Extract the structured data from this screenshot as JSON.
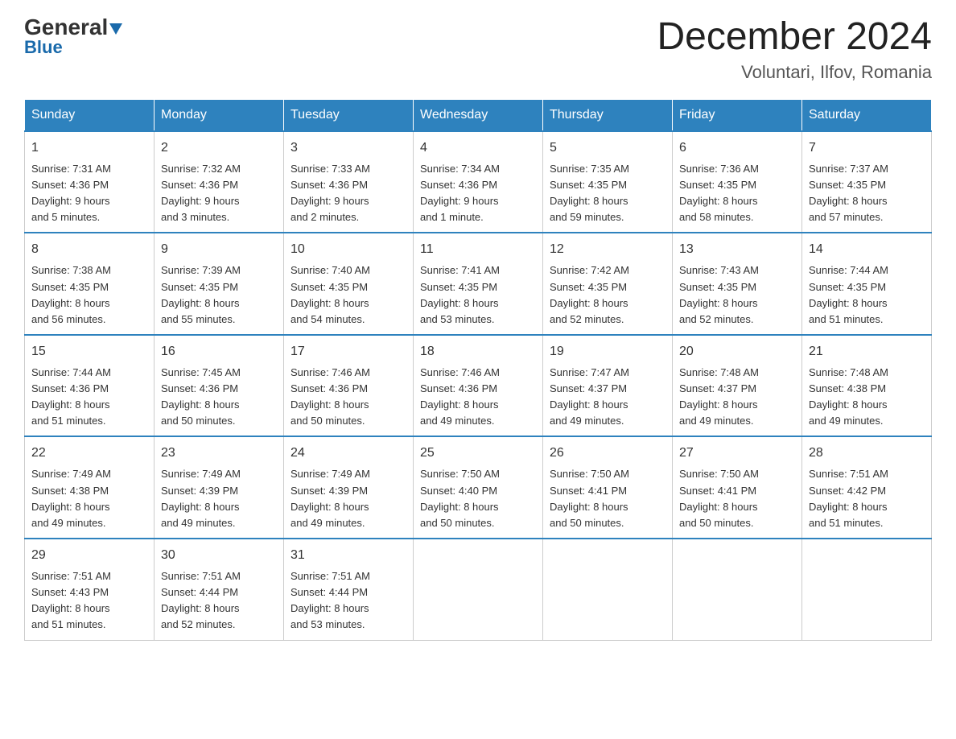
{
  "header": {
    "logo_general": "General",
    "logo_blue": "Blue",
    "month_year": "December 2024",
    "location": "Voluntari, Ilfov, Romania"
  },
  "days_of_week": [
    "Sunday",
    "Monday",
    "Tuesday",
    "Wednesday",
    "Thursday",
    "Friday",
    "Saturday"
  ],
  "weeks": [
    [
      {
        "day": "1",
        "sunrise": "7:31 AM",
        "sunset": "4:36 PM",
        "daylight": "9 hours and 5 minutes."
      },
      {
        "day": "2",
        "sunrise": "7:32 AM",
        "sunset": "4:36 PM",
        "daylight": "9 hours and 3 minutes."
      },
      {
        "day": "3",
        "sunrise": "7:33 AM",
        "sunset": "4:36 PM",
        "daylight": "9 hours and 2 minutes."
      },
      {
        "day": "4",
        "sunrise": "7:34 AM",
        "sunset": "4:36 PM",
        "daylight": "9 hours and 1 minute."
      },
      {
        "day": "5",
        "sunrise": "7:35 AM",
        "sunset": "4:35 PM",
        "daylight": "8 hours and 59 minutes."
      },
      {
        "day": "6",
        "sunrise": "7:36 AM",
        "sunset": "4:35 PM",
        "daylight": "8 hours and 58 minutes."
      },
      {
        "day": "7",
        "sunrise": "7:37 AM",
        "sunset": "4:35 PM",
        "daylight": "8 hours and 57 minutes."
      }
    ],
    [
      {
        "day": "8",
        "sunrise": "7:38 AM",
        "sunset": "4:35 PM",
        "daylight": "8 hours and 56 minutes."
      },
      {
        "day": "9",
        "sunrise": "7:39 AM",
        "sunset": "4:35 PM",
        "daylight": "8 hours and 55 minutes."
      },
      {
        "day": "10",
        "sunrise": "7:40 AM",
        "sunset": "4:35 PM",
        "daylight": "8 hours and 54 minutes."
      },
      {
        "day": "11",
        "sunrise": "7:41 AM",
        "sunset": "4:35 PM",
        "daylight": "8 hours and 53 minutes."
      },
      {
        "day": "12",
        "sunrise": "7:42 AM",
        "sunset": "4:35 PM",
        "daylight": "8 hours and 52 minutes."
      },
      {
        "day": "13",
        "sunrise": "7:43 AM",
        "sunset": "4:35 PM",
        "daylight": "8 hours and 52 minutes."
      },
      {
        "day": "14",
        "sunrise": "7:44 AM",
        "sunset": "4:35 PM",
        "daylight": "8 hours and 51 minutes."
      }
    ],
    [
      {
        "day": "15",
        "sunrise": "7:44 AM",
        "sunset": "4:36 PM",
        "daylight": "8 hours and 51 minutes."
      },
      {
        "day": "16",
        "sunrise": "7:45 AM",
        "sunset": "4:36 PM",
        "daylight": "8 hours and 50 minutes."
      },
      {
        "day": "17",
        "sunrise": "7:46 AM",
        "sunset": "4:36 PM",
        "daylight": "8 hours and 50 minutes."
      },
      {
        "day": "18",
        "sunrise": "7:46 AM",
        "sunset": "4:36 PM",
        "daylight": "8 hours and 49 minutes."
      },
      {
        "day": "19",
        "sunrise": "7:47 AM",
        "sunset": "4:37 PM",
        "daylight": "8 hours and 49 minutes."
      },
      {
        "day": "20",
        "sunrise": "7:48 AM",
        "sunset": "4:37 PM",
        "daylight": "8 hours and 49 minutes."
      },
      {
        "day": "21",
        "sunrise": "7:48 AM",
        "sunset": "4:38 PM",
        "daylight": "8 hours and 49 minutes."
      }
    ],
    [
      {
        "day": "22",
        "sunrise": "7:49 AM",
        "sunset": "4:38 PM",
        "daylight": "8 hours and 49 minutes."
      },
      {
        "day": "23",
        "sunrise": "7:49 AM",
        "sunset": "4:39 PM",
        "daylight": "8 hours and 49 minutes."
      },
      {
        "day": "24",
        "sunrise": "7:49 AM",
        "sunset": "4:39 PM",
        "daylight": "8 hours and 49 minutes."
      },
      {
        "day": "25",
        "sunrise": "7:50 AM",
        "sunset": "4:40 PM",
        "daylight": "8 hours and 50 minutes."
      },
      {
        "day": "26",
        "sunrise": "7:50 AM",
        "sunset": "4:41 PM",
        "daylight": "8 hours and 50 minutes."
      },
      {
        "day": "27",
        "sunrise": "7:50 AM",
        "sunset": "4:41 PM",
        "daylight": "8 hours and 50 minutes."
      },
      {
        "day": "28",
        "sunrise": "7:51 AM",
        "sunset": "4:42 PM",
        "daylight": "8 hours and 51 minutes."
      }
    ],
    [
      {
        "day": "29",
        "sunrise": "7:51 AM",
        "sunset": "4:43 PM",
        "daylight": "8 hours and 51 minutes."
      },
      {
        "day": "30",
        "sunrise": "7:51 AM",
        "sunset": "4:44 PM",
        "daylight": "8 hours and 52 minutes."
      },
      {
        "day": "31",
        "sunrise": "7:51 AM",
        "sunset": "4:44 PM",
        "daylight": "8 hours and 53 minutes."
      },
      null,
      null,
      null,
      null
    ]
  ],
  "labels": {
    "sunrise": "Sunrise:",
    "sunset": "Sunset:",
    "daylight": "Daylight:"
  }
}
